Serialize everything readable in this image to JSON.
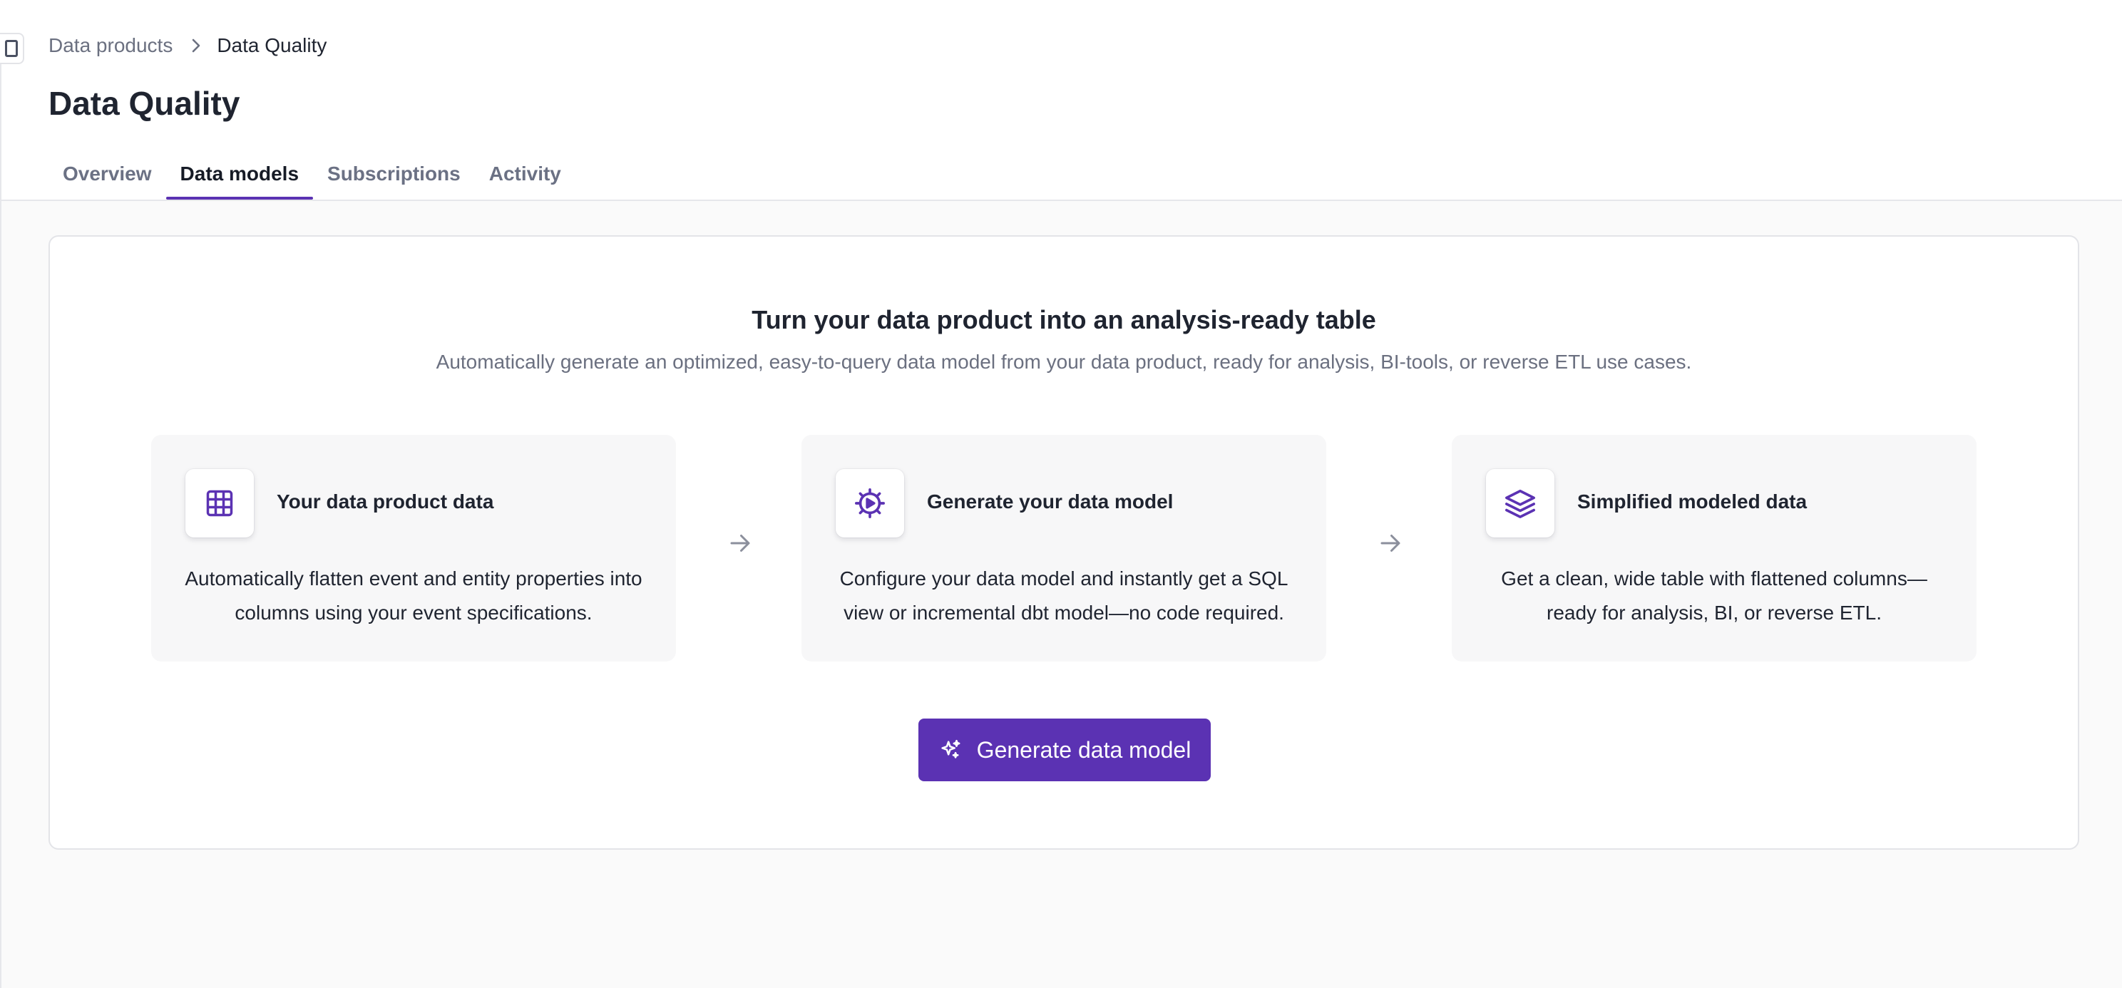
{
  "breadcrumb": {
    "parent": "Data products",
    "current": "Data Quality"
  },
  "page": {
    "title": "Data Quality"
  },
  "tabs": [
    {
      "label": "Overview",
      "active": false
    },
    {
      "label": "Data models",
      "active": true
    },
    {
      "label": "Subscriptions",
      "active": false
    },
    {
      "label": "Activity",
      "active": false
    }
  ],
  "intro": {
    "title": "Turn your data product into an analysis-ready table",
    "subtitle": "Automatically generate an optimized, easy-to-query data model from your data product, ready for analysis, BI-tools, or reverse ETL use cases."
  },
  "steps": [
    {
      "icon": "table-grid-icon",
      "title": "Your data product data",
      "description": "Automatically flatten event and entity properties into columns using your event specifications."
    },
    {
      "icon": "gear-play-icon",
      "title": "Generate your data model",
      "description": "Configure your data model and instantly get a SQL view or incremental dbt model—no code required."
    },
    {
      "icon": "layers-icon",
      "title": "Simplified modeled data",
      "description": "Get a clean, wide table with flattened columns—ready for analysis, BI, or reverse ETL."
    }
  ],
  "cta": {
    "label": "Generate data model",
    "icon": "sparkles-icon"
  },
  "colors": {
    "accent": "#5b32b3",
    "text_primary": "#1f2430",
    "text_muted": "#6b7080",
    "border": "#e3e4e8",
    "background": "#fafafa"
  }
}
